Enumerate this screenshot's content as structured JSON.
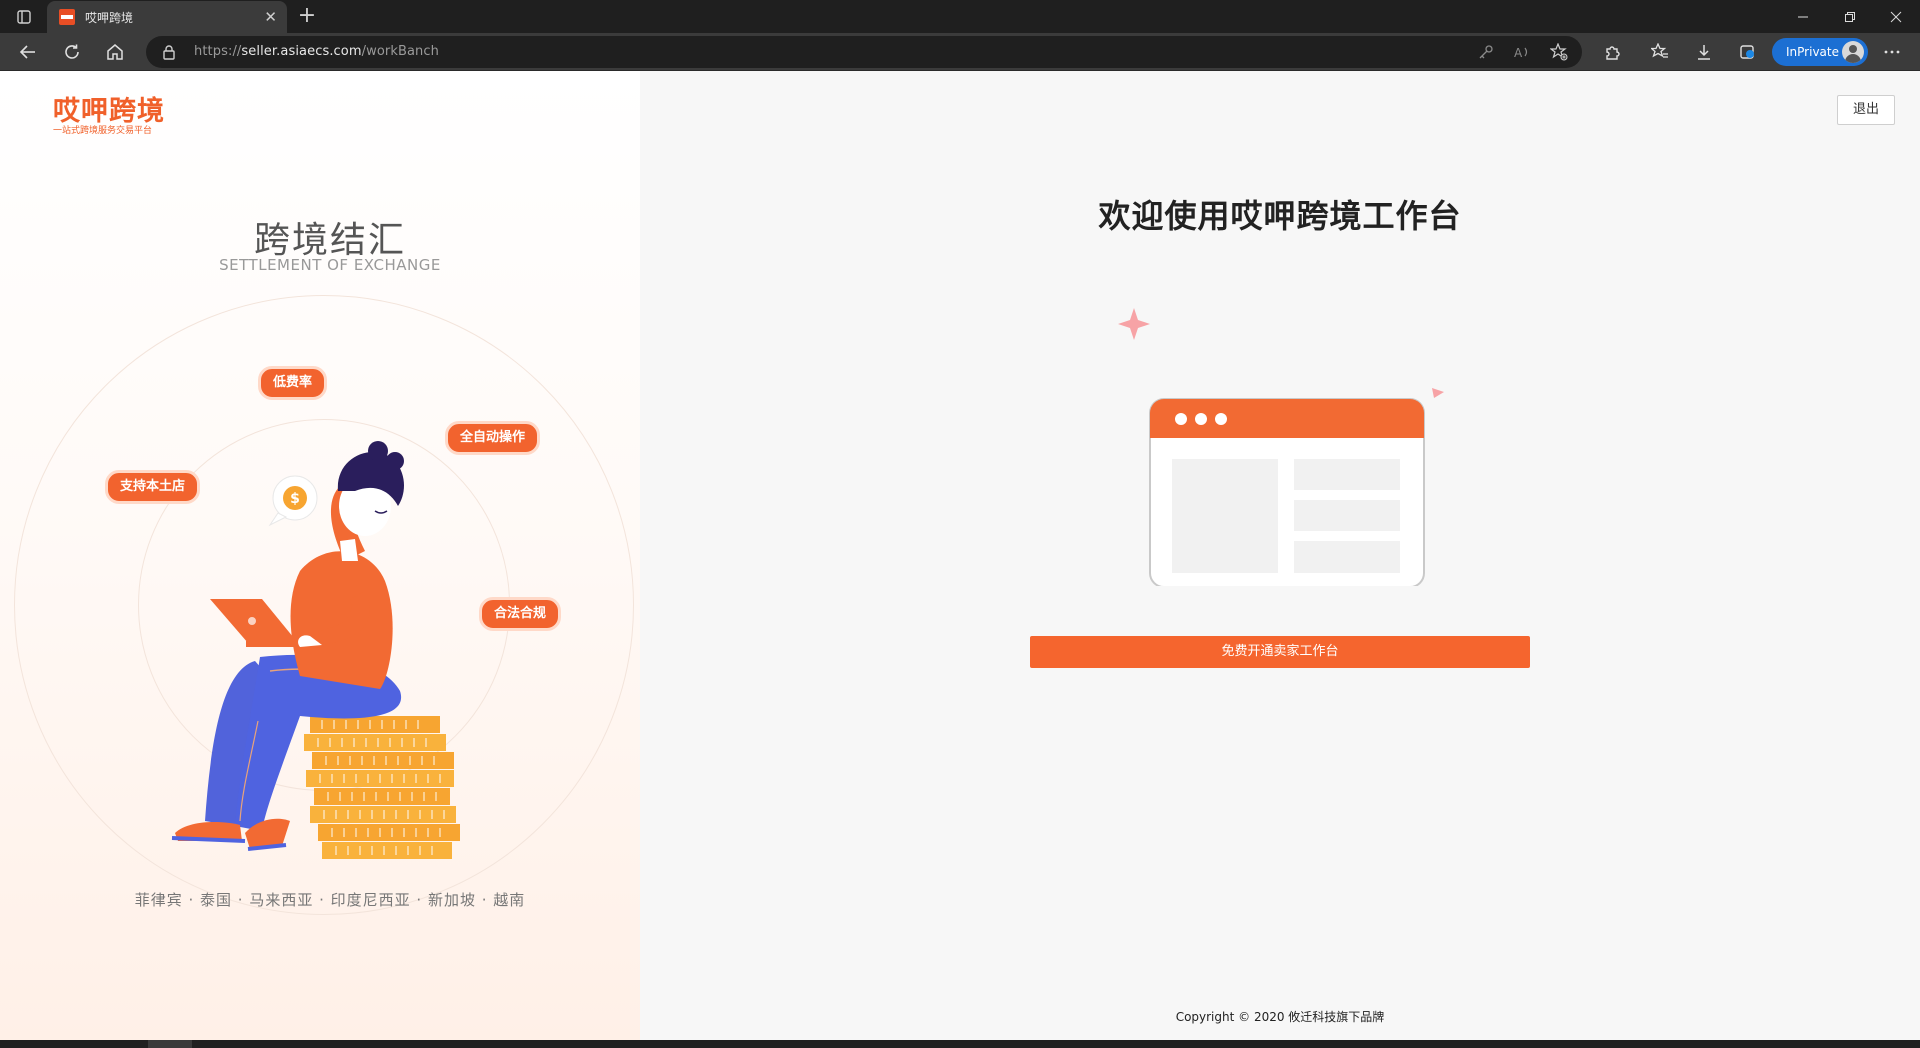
{
  "browser": {
    "tab_title": "哎呷跨境",
    "tab_close": "✕",
    "new_tab": "+",
    "url_prefix": "https://",
    "url_host": "seller.asiaecs.com",
    "url_path": "/workBanch",
    "inprivate_label": "InPrivate",
    "accent_color": "#1c6fd3"
  },
  "logo": {
    "name": "哎呷跨境",
    "slogan": "一站式跨境服务交易平台",
    "color": "#f0602a"
  },
  "left_panel": {
    "title": "跨境结汇",
    "subtitle": "SETTLEMENT OF EXCHANGE",
    "features": [
      "低费率",
      "全自动操作",
      "支持本土店",
      "合法合规"
    ],
    "coin_symbol": "$",
    "countries": "菲律宾 · 泰国 · 马来西亚 · 印度尼西亚 · 新加坡 · 越南"
  },
  "header": {
    "logout_label": "退出"
  },
  "main": {
    "welcome": "欢迎使用哎呷跨境工作台",
    "cta_label": "免费开通卖家工作台",
    "cta_color": "#f5652e"
  },
  "footer": {
    "copyright": "Copyright © 2020 攸迁科技旗下品牌"
  }
}
